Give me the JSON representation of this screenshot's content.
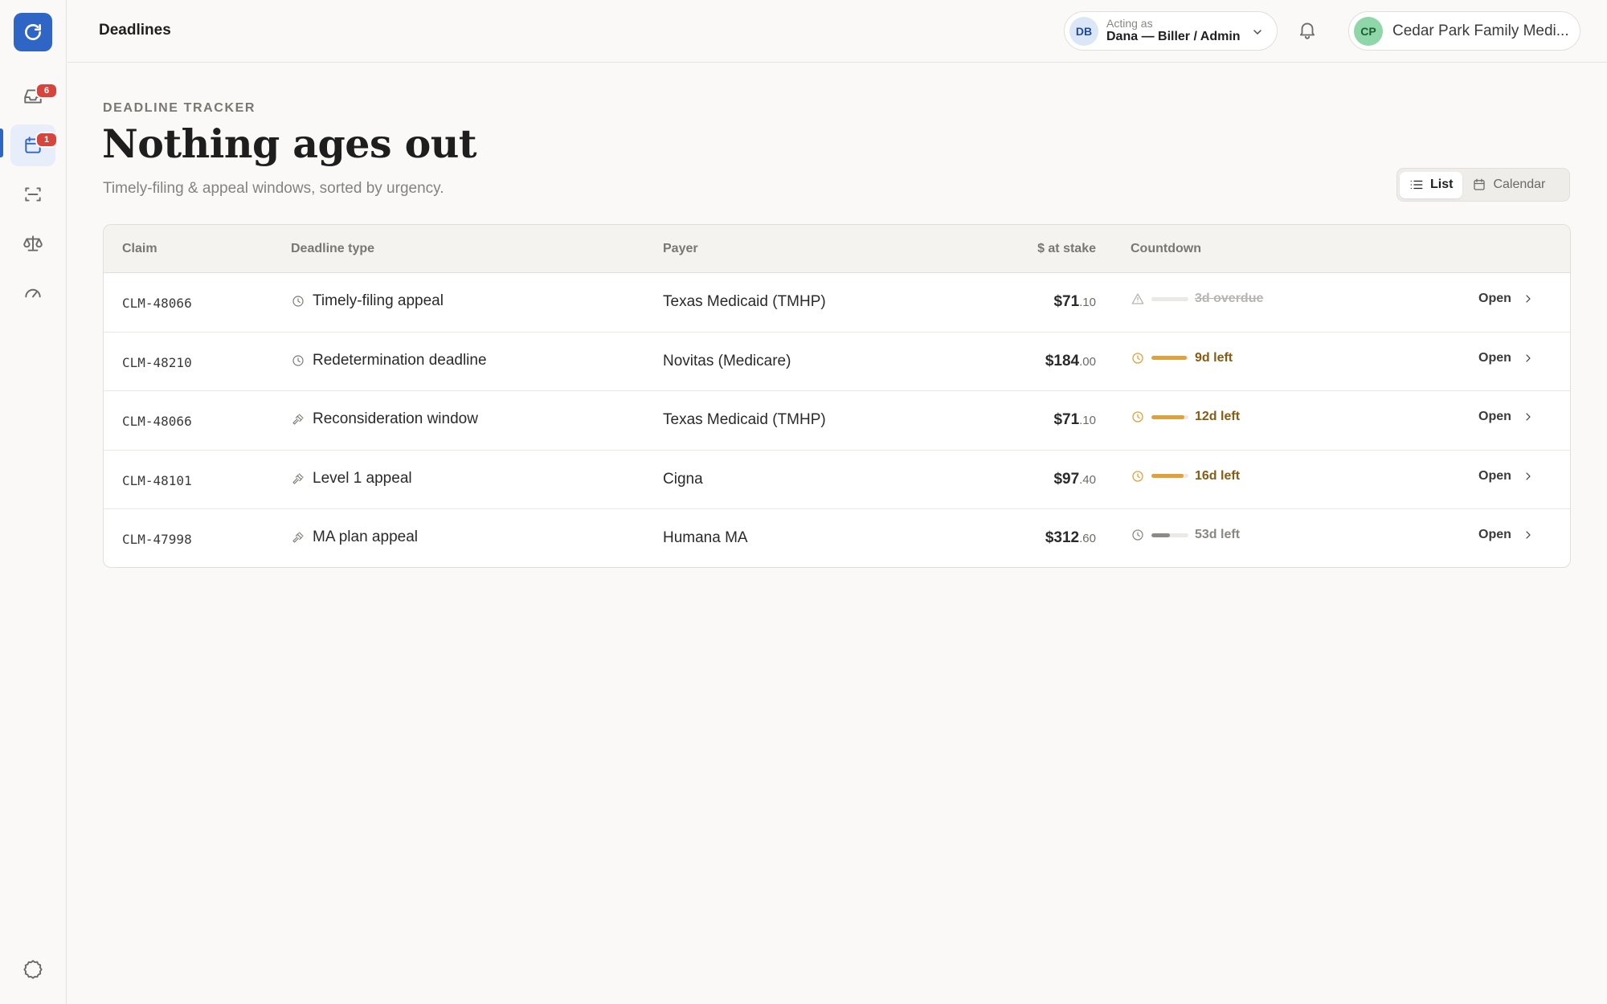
{
  "app": {
    "logo_icon": "refresh-logo-icon"
  },
  "sidebar": {
    "items": [
      {
        "icon": "inbox-icon",
        "badge": "6"
      },
      {
        "icon": "calendar-icon",
        "badge": "1",
        "active": true
      },
      {
        "icon": "scan-icon",
        "badge": ""
      },
      {
        "icon": "scales-icon",
        "badge": ""
      },
      {
        "icon": "gauge-icon",
        "badge": ""
      }
    ],
    "footer_icon": "settings-badge-icon"
  },
  "header": {
    "title": "Deadlines",
    "acting_as_label": "Acting as",
    "acting_as_initials": "DB",
    "acting_as_name": "Dana — Biller / Admin",
    "org_initials": "CP",
    "org_name": "Cedar Park Family Medi..."
  },
  "page": {
    "eyebrow": "DEADLINE TRACKER",
    "title": "Nothing ages out",
    "subtitle": "Timely-filing & appeal windows, sorted by urgency.",
    "view_toggle": {
      "list_label": "List",
      "calendar_label": "Calendar",
      "selected": "List"
    }
  },
  "table": {
    "columns": [
      "Claim",
      "Deadline type",
      "Payer",
      "$ at stake",
      "Countdown"
    ],
    "open_label": "Open",
    "rows": [
      {
        "claim": "CLM-48066",
        "type": "Timely-filing appeal",
        "type_icon": "clock-icon",
        "payer": "Texas Medicaid (TMHP)",
        "amount_dollars": "$71",
        "amount_cents": ".10",
        "countdown": "3d overdue",
        "status": "overdue",
        "progress": 1.0
      },
      {
        "claim": "CLM-48210",
        "type": "Redetermination deadline",
        "type_icon": "clock-icon",
        "payer": "Novitas (Medicare)",
        "amount_dollars": "$184",
        "amount_cents": ".00",
        "countdown": "9d left",
        "status": "warning",
        "progress": 0.95
      },
      {
        "claim": "CLM-48066",
        "type": "Reconsideration window",
        "type_icon": "gavel-icon",
        "payer": "Texas Medicaid (TMHP)",
        "amount_dollars": "$71",
        "amount_cents": ".10",
        "countdown": "12d left",
        "status": "warning",
        "progress": 0.9
      },
      {
        "claim": "CLM-48101",
        "type": "Level 1 appeal",
        "type_icon": "gavel-icon",
        "payer": "Cigna",
        "amount_dollars": "$97",
        "amount_cents": ".40",
        "countdown": "16d left",
        "status": "warning",
        "progress": 0.88
      },
      {
        "claim": "CLM-47998",
        "type": "MA plan appeal",
        "type_icon": "gavel-icon",
        "payer": "Humana MA",
        "amount_dollars": "$312",
        "amount_cents": ".60",
        "countdown": "53d left",
        "status": "ok",
        "progress": 0.5
      }
    ]
  },
  "colors": {
    "accent": "#2f66c5",
    "warning": "#e0a03a",
    "warning_text": "#8a5a12",
    "overdue_text": "#b8b5b1",
    "ok_bar": "#8d8a86",
    "ok_text": "#8a8782",
    "badge": "#d6453d"
  }
}
